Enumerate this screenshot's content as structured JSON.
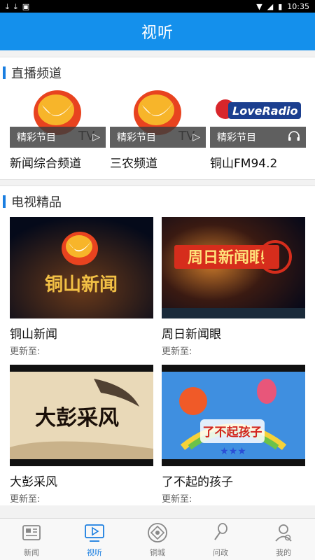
{
  "status_bar": {
    "icons_left": [
      "download-icon",
      "download-icon",
      "notification-icon"
    ],
    "time": "10:35"
  },
  "header": {
    "title": "视听"
  },
  "live_section": {
    "title": "直播频道",
    "channels": [
      {
        "name": "新闻综合频道",
        "overlay": "精彩节目",
        "overlay_icon": "play-icon"
      },
      {
        "name": "三农频道",
        "overlay": "精彩节目",
        "overlay_icon": "play-icon"
      },
      {
        "name": "铜山FM94.2",
        "overlay": "精彩节目",
        "overlay_icon": "headphones-icon"
      }
    ]
  },
  "tv_section": {
    "title": "电视精品",
    "programs": [
      {
        "name": "铜山新闻",
        "update": "更新至:",
        "thumb_text": "铜山新闻"
      },
      {
        "name": "周日新闻眼",
        "update": "更新至:",
        "thumb_text": "周日新闻眼"
      },
      {
        "name": "大彭采风",
        "update": "更新至:",
        "thumb_text": "大彭采风"
      },
      {
        "name": "了不起的孩子",
        "update": "更新至:",
        "thumb_text": "了不起孩子"
      }
    ]
  },
  "bottom_nav": [
    {
      "label": "新闻",
      "icon": "newspaper-icon",
      "active": false
    },
    {
      "label": "视听",
      "icon": "play-icon",
      "active": true
    },
    {
      "label": "铜城",
      "icon": "city-icon",
      "active": false
    },
    {
      "label": "问政",
      "icon": "microphone-icon",
      "active": false
    },
    {
      "label": "我的",
      "icon": "user-icon",
      "active": false
    }
  ],
  "brand_colors": {
    "primary": "#1490ec",
    "accent": "#1a7ee0"
  }
}
